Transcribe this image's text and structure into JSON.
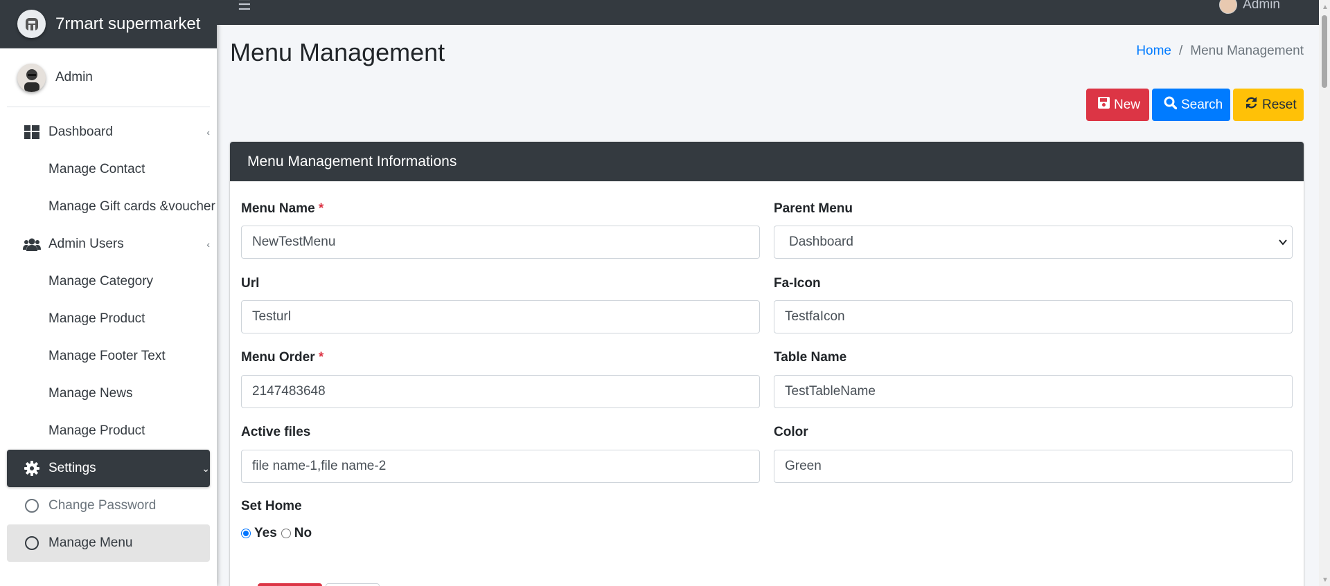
{
  "brand": {
    "name": "7rmart supermarket"
  },
  "user": {
    "name": "Admin"
  },
  "topbar": {
    "user_name": "Admin"
  },
  "sidebar": {
    "items": [
      {
        "label": "Dashboard",
        "icon": "dashboard-icon",
        "type": "parent"
      },
      {
        "label": "Manage Contact",
        "type": "sub"
      },
      {
        "label": "Manage Gift cards &voucher",
        "type": "sub"
      },
      {
        "label": "Admin Users",
        "icon": "users-icon",
        "type": "parent"
      },
      {
        "label": "Manage Category",
        "type": "sub"
      },
      {
        "label": "Manage Product",
        "type": "sub"
      },
      {
        "label": "Manage Footer Text",
        "type": "sub"
      },
      {
        "label": "Manage News",
        "type": "sub"
      },
      {
        "label": "Manage Product",
        "type": "sub"
      },
      {
        "label": "Settings",
        "icon": "gear-icon",
        "type": "active"
      },
      {
        "label": "Change Password",
        "icon": "circle-icon",
        "type": "child"
      },
      {
        "label": "Manage Menu",
        "icon": "circle-icon",
        "type": "current"
      }
    ]
  },
  "page": {
    "title": "Menu Management"
  },
  "breadcrumb": {
    "home": "Home",
    "separator": "/",
    "current": "Menu Management"
  },
  "actions": {
    "new": "New",
    "search": "Search",
    "reset": "Reset"
  },
  "card": {
    "title": "Menu Management Informations"
  },
  "form": {
    "menu_name": {
      "label": "Menu Name",
      "required": "*",
      "value": "NewTestMenu"
    },
    "parent_menu": {
      "label": "Parent Menu",
      "value": "Dashboard"
    },
    "url": {
      "label": "Url",
      "value": "Testurl"
    },
    "fa_icon": {
      "label": "Fa-Icon",
      "value": "TestfaIcon"
    },
    "menu_order": {
      "label": "Menu Order",
      "required": "*",
      "value": "2147483648"
    },
    "table_name": {
      "label": "Table Name",
      "value": "TestTableName"
    },
    "active_files": {
      "label": "Active files",
      "value": "file name-1,file name-2"
    },
    "color": {
      "label": "Color",
      "value": "Green"
    },
    "set_home": {
      "label": "Set Home",
      "yes": "Yes",
      "no": "No",
      "selected": "Yes"
    }
  },
  "colors": {
    "danger": "#dc3545",
    "primary": "#007bff",
    "warning": "#ffc107",
    "dark": "#343a40"
  }
}
